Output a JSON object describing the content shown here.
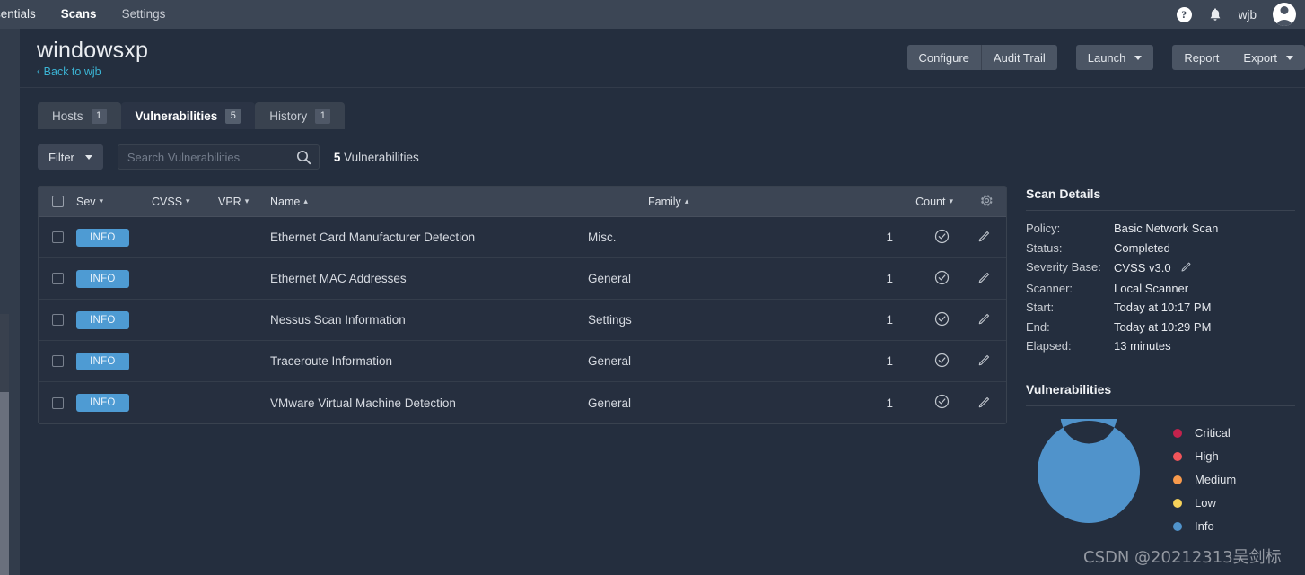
{
  "topnav": {
    "brand": "sentials",
    "items": [
      {
        "label": "Scans",
        "active": true
      },
      {
        "label": "Settings",
        "active": false
      }
    ],
    "help_icon": "help-circle-icon",
    "bell_icon": "bell-icon",
    "username": "wjb",
    "avatar_icon": "user-avatar-icon",
    "help_glyph": "?"
  },
  "header": {
    "title": "windowsxp",
    "back_label": "Back to wjb",
    "back_chevron": "‹",
    "buttons": {
      "configure": "Configure",
      "audit_trail": "Audit Trail",
      "launch": "Launch",
      "report": "Report",
      "export": "Export"
    }
  },
  "tabs": [
    {
      "label": "Hosts",
      "badge": "1",
      "active": false
    },
    {
      "label": "Vulnerabilities",
      "badge": "5",
      "active": true
    },
    {
      "label": "History",
      "badge": "1",
      "active": false
    }
  ],
  "filterbar": {
    "filter_label": "Filter",
    "search_placeholder": "Search Vulnerabilities",
    "search_value": "",
    "search_icon": "search-icon",
    "count_number": "5",
    "count_label": "Vulnerabilities"
  },
  "table": {
    "columns": {
      "sev": "Sev",
      "cvss": "CVSS",
      "vpr": "VPR",
      "name": "Name",
      "family": "Family",
      "count": "Count"
    },
    "sort_arrows": {
      "sev": "▾",
      "cvss": "▾",
      "vpr": "▾",
      "name": "▴",
      "family": "▴",
      "count": "▾"
    },
    "gear_icon": "settings-gear-icon",
    "rows": [
      {
        "severity": "INFO",
        "cvss": "",
        "vpr": "",
        "name": "Ethernet Card Manufacturer Detection",
        "family": "Misc.",
        "count": "1"
      },
      {
        "severity": "INFO",
        "cvss": "",
        "vpr": "",
        "name": "Ethernet MAC Addresses",
        "family": "General",
        "count": "1"
      },
      {
        "severity": "INFO",
        "cvss": "",
        "vpr": "",
        "name": "Nessus Scan Information",
        "family": "Settings",
        "count": "1"
      },
      {
        "severity": "INFO",
        "cvss": "",
        "vpr": "",
        "name": "Traceroute Information",
        "family": "General",
        "count": "1"
      },
      {
        "severity": "INFO",
        "cvss": "",
        "vpr": "",
        "name": "VMware Virtual Machine Detection",
        "family": "General",
        "count": "1"
      }
    ]
  },
  "scan_details": {
    "heading": "Scan Details",
    "fields": [
      {
        "label": "Policy:",
        "value": "Basic Network Scan"
      },
      {
        "label": "Status:",
        "value": "Completed"
      },
      {
        "label": "Severity Base:",
        "value": "CVSS v3.0",
        "edit_icon": "pencil-edit-icon"
      },
      {
        "label": "Scanner:",
        "value": "Local Scanner"
      },
      {
        "label": "Start:",
        "value": "Today at 10:17 PM"
      },
      {
        "label": "End:",
        "value": "Today at 10:29 PM"
      },
      {
        "label": "Elapsed:",
        "value": "13 minutes"
      }
    ]
  },
  "chart_data": {
    "type": "pie",
    "title": "Vulnerabilities",
    "categories": [
      "Critical",
      "High",
      "Medium",
      "Low",
      "Info"
    ],
    "values": [
      0,
      0,
      0,
      0,
      5
    ],
    "colors": [
      "#c4224c",
      "#f2555a",
      "#f89a4c",
      "#f7d25a",
      "#5093cb"
    ],
    "legend_position": "right",
    "donut": true,
    "total": 5
  },
  "colors": {
    "accent_blue": "#4e9bd3",
    "link_cyan": "#3bb4d4",
    "nav_bg": "#3c4655",
    "page_bg": "#242e3e",
    "table_header_bg": "#3c4554",
    "row_bg": "#262f3f"
  },
  "watermark": "CSDN @20212313吴剑标"
}
